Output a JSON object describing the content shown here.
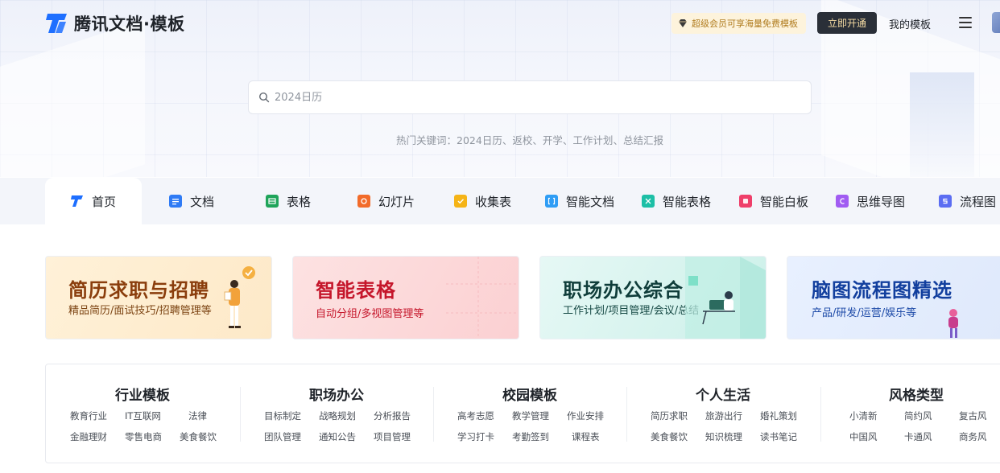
{
  "header": {
    "logo_text": "腾讯文档·模板",
    "promo_text": "超级会员可享海量免费模板",
    "open_button": "立即开通",
    "my_templates": "我的模板"
  },
  "search": {
    "placeholder": "2024日历",
    "hot_label": "热门关键词：",
    "hot_words": [
      "2024日历",
      "返校",
      "开学",
      "工作计划",
      "总结汇报"
    ],
    "separator": "、"
  },
  "tabs": [
    {
      "label": "首页",
      "icon": "tencent-docs-logo-icon",
      "color": "#1e6fff",
      "active": true
    },
    {
      "label": "文档",
      "icon": "doc-icon",
      "color": "#2f7bf5"
    },
    {
      "label": "表格",
      "icon": "sheet-icon",
      "color": "#1fa45a"
    },
    {
      "label": "幻灯片",
      "icon": "slide-icon",
      "color": "#f26b2a"
    },
    {
      "label": "收集表",
      "icon": "form-icon",
      "color": "#f5b417"
    },
    {
      "label": "智能文档",
      "icon": "smart-doc-icon",
      "color": "#2f9df5"
    },
    {
      "label": "智能表格",
      "icon": "smart-sheet-icon",
      "color": "#1dbfa6"
    },
    {
      "label": "智能白板",
      "icon": "whiteboard-icon",
      "color": "#ef3f6a"
    },
    {
      "label": "思维导图",
      "icon": "mindmap-icon",
      "color": "#a15cf2"
    },
    {
      "label": "流程图",
      "icon": "flowchart-icon",
      "color": "#5b6df2"
    }
  ],
  "banners": [
    {
      "title": "简历求职与招聘",
      "subtitle": "精品简历/面试技巧/招聘管理等"
    },
    {
      "title": "智能表格",
      "subtitle": "自动分组/多视图管理等"
    },
    {
      "title": "职场办公综合",
      "subtitle": "工作计划/项目管理/会议/总结"
    },
    {
      "title": "脑图流程图精选",
      "subtitle": "产品/研发/运营/娱乐等"
    }
  ],
  "categories": [
    {
      "title": "行业模板",
      "items": [
        "教育行业",
        "IT互联网",
        "法律",
        "金融理财",
        "零售电商",
        "美食餐饮"
      ]
    },
    {
      "title": "职场办公",
      "items": [
        "目标制定",
        "战略规划",
        "分析报告",
        "团队管理",
        "通知公告",
        "项目管理"
      ]
    },
    {
      "title": "校园模板",
      "items": [
        "高考志愿",
        "教学管理",
        "作业安排",
        "学习打卡",
        "考勤签到",
        "课程表"
      ]
    },
    {
      "title": "个人生活",
      "items": [
        "简历求职",
        "旅游出行",
        "婚礼策划",
        "美食餐饮",
        "知识梳理",
        "读书笔记"
      ]
    },
    {
      "title": "风格类型",
      "items": [
        "小清新",
        "简约风",
        "复古风",
        "中国风",
        "卡通风",
        "商务风"
      ]
    }
  ]
}
